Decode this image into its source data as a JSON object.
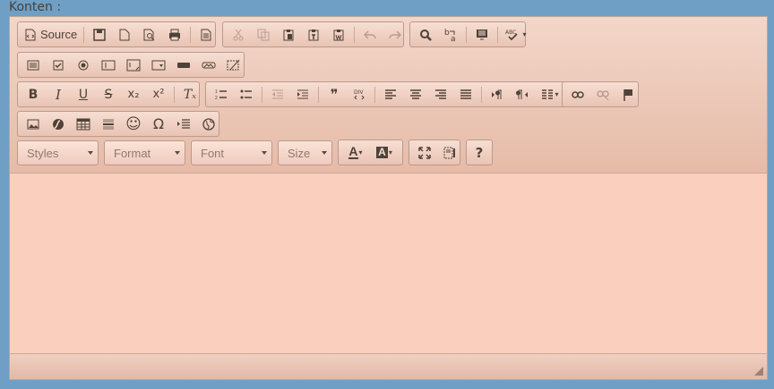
{
  "field_label": "Konten :",
  "toolbar": {
    "source_label": "Source",
    "combos": {
      "styles": "Styles",
      "format": "Format",
      "font": "Font",
      "size": "Size"
    },
    "help_label": "?"
  },
  "icons": {
    "strikethrough_glyph": "S",
    "subscript_glyph": "x₂",
    "superscript_glyph": "x²",
    "remove_format_glyph": "Tₓ",
    "blockquote_glyph": "❞",
    "omega_glyph": "Ω",
    "smiley_glyph": "☺",
    "bold_glyph": "B",
    "italic_glyph": "I",
    "underline_glyph": "U",
    "text_color_glyph": "A",
    "bg_color_glyph": "A"
  },
  "colors": {
    "background": "#6f9fc4",
    "editor_bg": "#facfbd",
    "toolbar_bg": "#f3d6c9"
  }
}
